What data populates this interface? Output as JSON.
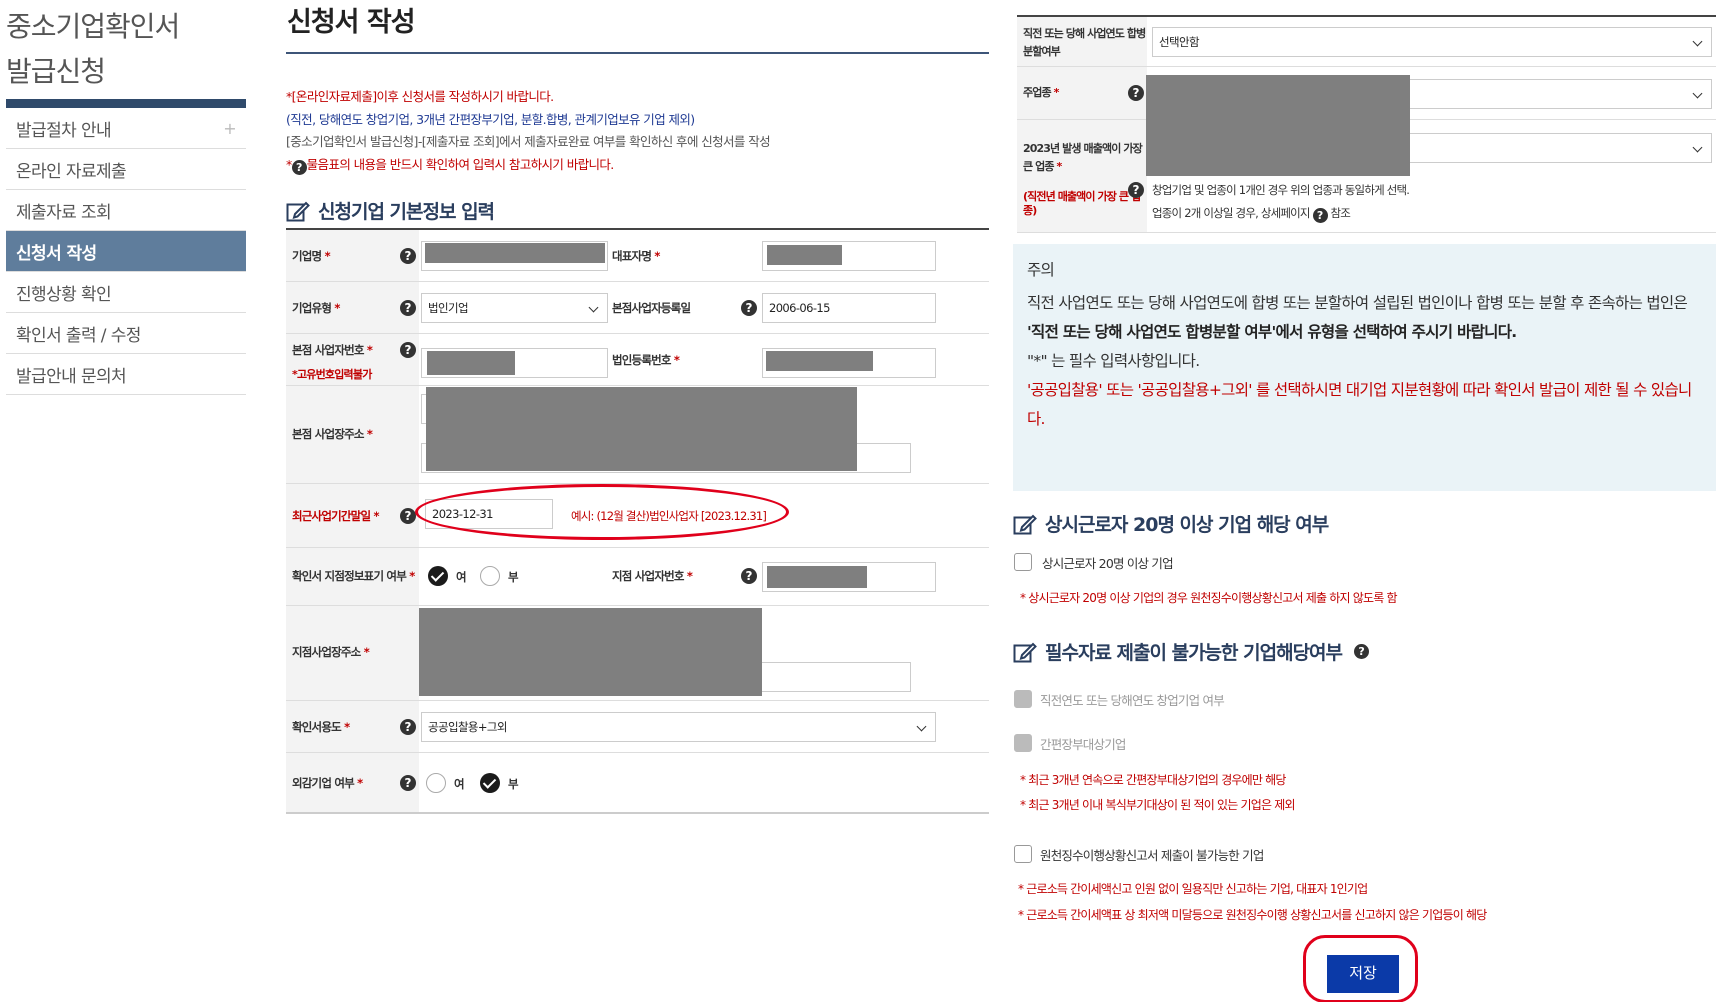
{
  "sidebar": {
    "title_line1": "중소기업확인서",
    "title_line2": "발급신청",
    "items": [
      {
        "label": "발급절차 안내",
        "plus": "+"
      },
      {
        "label": "온라인 자료제출"
      },
      {
        "label": "제출자료 조회"
      },
      {
        "label": "신청서 작성"
      },
      {
        "label": "진행상황 확인"
      },
      {
        "label": "확인서 출력 / 수정"
      },
      {
        "label": "발급안내 문의처"
      }
    ]
  },
  "main": {
    "title": "신청서 작성",
    "notice": {
      "line1": "*[온라인자료제출]이후 신청서를 작성하시기 바랍니다.",
      "line2": "(직전, 당해연도 창업기업, 3개년 간편장부기업, 분할.합병, 관계기업보유 기업 제외)",
      "line3": "[중소기업확인서 발급신청]-[제출자료 조회]에서 제출자료완료 여부를 확인하신 후에 신청서를 작성",
      "line4_prefix": "*",
      "line4_q": "?",
      "line4_text": "물음표의 내용을 반드시 확인하여 입력시 참고하시기 바랍니다."
    },
    "section_title": "신청기업 기본정보 입력",
    "form": {
      "company_name_label": "기업명",
      "ceo_label": "대표자명",
      "company_type_label": "기업유형",
      "company_type_value": "법인기업",
      "hq_reg_date_label": "본점사업자등록일",
      "hq_reg_date_value": "2006-06-15",
      "hq_bizno_label": "본점 사업자번호",
      "hq_bizno_sub": "*고유번호입력불가",
      "corp_regno_label": "법인등록번호",
      "hq_address_label": "본점 사업장주소",
      "fiscal_end_label": "최근사업기간말일",
      "fiscal_end_value": "2023-12-31",
      "fiscal_end_example": "예시: (12월 결산)법인사업자 [2023.12.31]",
      "branch_display_label": "확인서 지점정보표기 여부",
      "yes": "여",
      "no": "부",
      "branch_bizno_label": "지점 사업자번호",
      "branch_address_label": "지점사업장주소",
      "purpose_label": "확인서용도",
      "purpose_value": "공공입찰용+그외",
      "foreign_label": "외감기업 여부",
      "star": "*",
      "help": "?"
    }
  },
  "right": {
    "merger_label": "직전 또는 당해 사업연도 합병분할여부",
    "merger_value": "선택안함",
    "main_industry_label": "주업종",
    "max_sales_label": "2023년 발생 매출액이 가장 큰 업종",
    "prev_sales_label": "(직전년 매출액이 가장 큰 업종)",
    "industry_note1": "창업기업 및 업종이 1개인 경우 위의 업종과 동일하게 선택.",
    "industry_note2_a": "업종이 2개 이상일 경우, 상세페이지",
    "industry_note2_b": "참조",
    "caution": {
      "title": "주의",
      "p1": "직전 사업연도 또는 당해 사업연도에 합병 또는 분할하여 설립된 법인이나 합병 또는 분할 후 존속하는 법인은",
      "p2": "'직전 또는 당해 사업연도 합병분할 여부'에서 유형을 선택하여 주시기 바랍니다.",
      "p3": "\"*\" 는 필수 입력사항입니다.",
      "p4": "'공공입찰용' 또는 '공공입찰용+그외' 를 선택하시면 대기업 지분현황에 따라 확인서 발급이 제한 될 수 있습니다."
    },
    "sec2_title": "상시근로자 20명 이상 기업 해당 여부",
    "sec2_check": "상시근로자 20명 이상 기업",
    "sec2_note": "*  상시근로자 20명 이상 기업의 경우 원천징수이행상황신고서 제출 하지 않도록 함",
    "sec3_title": "필수자료 제출이 불가능한 기업해당여부",
    "sec3_check1": "직전연도 또는 당해연도 창업기업 여부",
    "sec3_check2": "간편장부대상기업",
    "sec3_note1": "*  최근 3개년 연속으로 간편장부대상기업의 경우에만 해당",
    "sec3_note2": "*  최근 3개년 이내 복식부기대상이 된 적이 있는 기업은 제외",
    "sec3_check3": "원천징수이행상황신고서 제출이 불가능한 기업",
    "sec3_note3": "*  근로소득 간이세액신고 인원 없이 일용직만 신고하는 기업, 대표자 1인기업",
    "sec3_note4": "*  근로소득 간이세액표 상 최저액 미달등으로 원천징수이행 상황신고서를 신고하지 않은 기업등이 해당",
    "save_label": "저장"
  },
  "colors": {
    "navy": "#2f4a6b",
    "active_menu": "#5f7d9c",
    "required": "#c00000",
    "save": "#0b3aa8",
    "highlight": "#e0001b",
    "caution_bg": "#eaf3f7"
  }
}
